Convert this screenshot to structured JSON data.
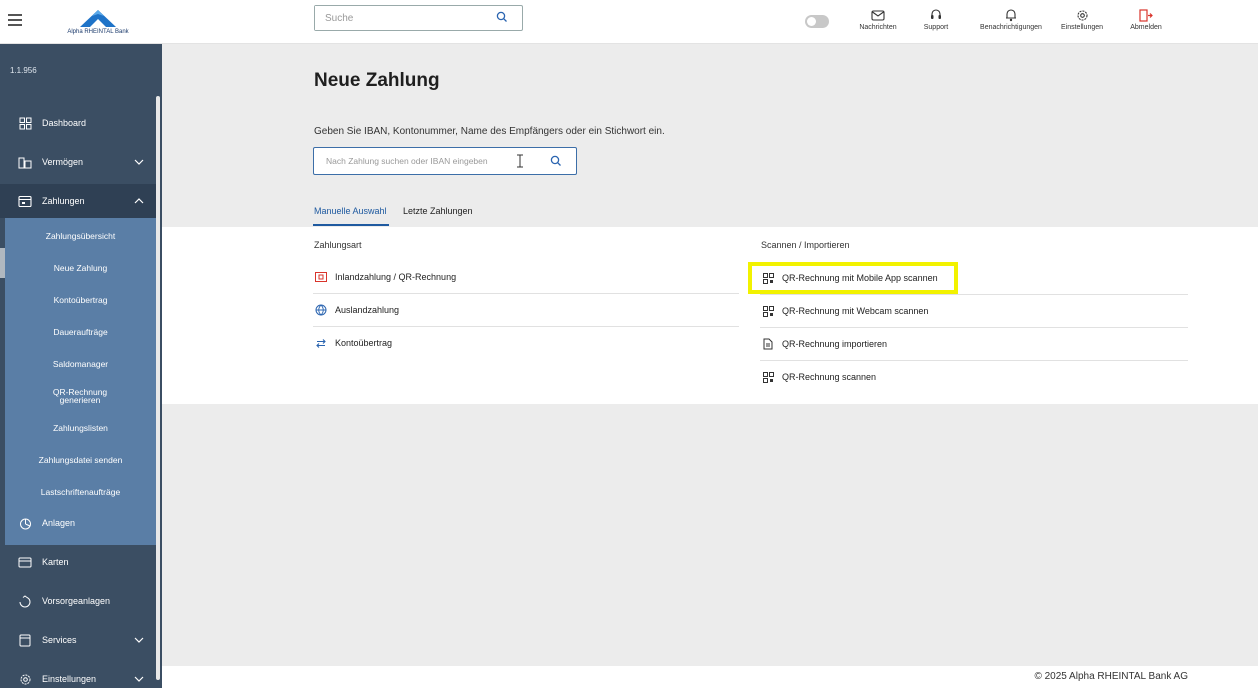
{
  "header": {
    "logo_text": "Alpha RHEINTAL Bank",
    "search_placeholder": "Suche",
    "tools": [
      {
        "label": "Nachrichten",
        "icon": "envelope-icon"
      },
      {
        "label": "Support",
        "icon": "headset-icon"
      },
      {
        "label": "Benachrichtigungen",
        "icon": "bell-icon"
      },
      {
        "label": "Einstellungen",
        "icon": "gear-icon"
      },
      {
        "label": "Abmelden",
        "icon": "logout-icon"
      }
    ],
    "logout_color": "#d9342b"
  },
  "sidebar": {
    "version": "1.1.956",
    "items": [
      {
        "label": "Dashboard",
        "icon": "dashboard-icon"
      },
      {
        "label": "Vermögen",
        "icon": "wealth-icon"
      },
      {
        "label": "Zahlungen",
        "icon": "payments-icon"
      },
      {
        "label": "Anlagen",
        "icon": "investments-icon"
      },
      {
        "label": "Karten",
        "icon": "card-icon"
      },
      {
        "label": "Vorsorgeanlagen",
        "icon": "pension-icon"
      },
      {
        "label": "Services",
        "icon": "services-icon"
      },
      {
        "label": "Einstellungen",
        "icon": "gear-icon"
      }
    ],
    "sub_items": [
      "Zahlungsübersicht",
      "Neue Zahlung",
      "Kontoübertrag",
      "Daueraufträge",
      "Saldomanager",
      "QR-Rechnung generieren",
      "Zahlungslisten",
      "Zahlungsdatei senden",
      "Lastschriftenaufträge"
    ],
    "active_sub": "Neue Zahlung"
  },
  "main": {
    "title": "Neue Zahlung",
    "instruction": "Geben Sie IBAN, Kontonummer, Name des Empfängers oder ein Stichwort ein.",
    "search_placeholder": "Nach Zahlung suchen oder IBAN eingeben",
    "tabs": [
      {
        "label": "Manuelle Auswahl",
        "active": true
      },
      {
        "label": "Letzte Zahlungen",
        "active": false
      }
    ],
    "payment_type_header": "Zahlungsart",
    "payment_types": [
      {
        "label": "Inlandzahlung / QR-Rechnung",
        "icon": "qr-bill-icon"
      },
      {
        "label": "Auslandzahlung",
        "icon": "globe-icon"
      },
      {
        "label": "Kontoübertrag",
        "icon": "transfer-arrows-icon"
      }
    ],
    "scan_header": "Scannen / Importieren",
    "scan_options": [
      {
        "label": "QR-Rechnung mit Mobile App scannen",
        "icon": "qr-code-icon"
      },
      {
        "label": "QR-Rechnung mit Webcam scannen",
        "icon": "qr-code-icon"
      },
      {
        "label": "QR-Rechnung importieren",
        "icon": "document-icon"
      },
      {
        "label": "QR-Rechnung scannen",
        "icon": "qr-code-icon"
      }
    ],
    "highlight_color": "#f2f200",
    "accent_color": "#1f5aa0"
  },
  "footer": {
    "copyright": "© 2025 Alpha RHEINTAL Bank AG"
  }
}
